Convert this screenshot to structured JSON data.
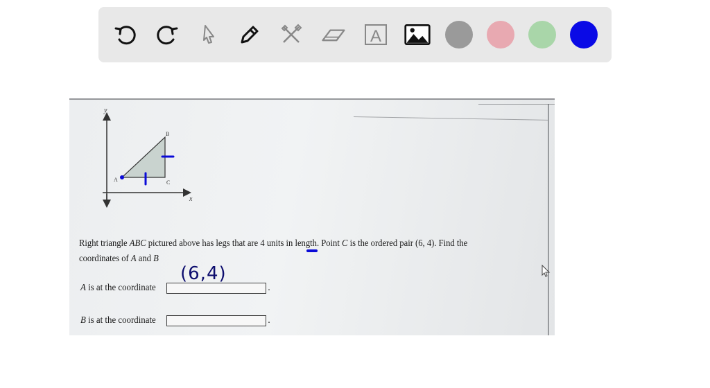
{
  "toolbar": {
    "tools": [
      {
        "name": "undo-icon"
      },
      {
        "name": "redo-icon"
      },
      {
        "name": "pointer-icon"
      },
      {
        "name": "pen-icon"
      },
      {
        "name": "tools-icon"
      },
      {
        "name": "eraser-icon"
      },
      {
        "name": "text-icon",
        "glyph": "A"
      },
      {
        "name": "image-icon"
      }
    ],
    "colors": [
      "#9a9a9a",
      "#e8a9b1",
      "#a9d6a9",
      "#0a0ae6"
    ]
  },
  "graph": {
    "y_label": "y",
    "x_label": "x",
    "point_a": "A",
    "point_b": "B",
    "point_c": "C"
  },
  "handwriting": {
    "point_note": "(6,4)"
  },
  "question": {
    "part1": "Right triangle ",
    "abc": "ABC",
    "part2": " pictured above has legs that are ",
    "leg_length": "4",
    "part3": " units in length. Point ",
    "c": "C",
    "part4": " is the ordered pair (6, 4). Find the coordinates of ",
    "a": "A",
    "part5": " and ",
    "b": "B"
  },
  "answers": [
    {
      "var": "A",
      "label": " is at the coordinate",
      "value": ""
    },
    {
      "var": "B",
      "label": " is at the coordinate",
      "value": ""
    }
  ]
}
